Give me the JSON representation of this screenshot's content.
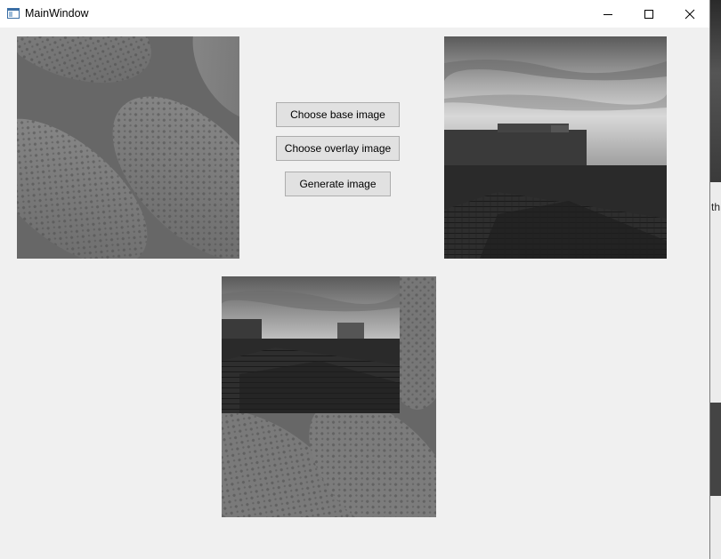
{
  "window": {
    "title": "MainWindow",
    "icon": "app-window-icon",
    "controls": [
      "minimize-icon",
      "maximize-icon",
      "close-icon"
    ]
  },
  "buttons": {
    "choose_base": "Choose base image",
    "choose_overlay": "Choose overlay image",
    "generate": "Generate image"
  },
  "images": {
    "base": "grayscale textured seeds photo",
    "overlay": "grayscale rooftops at sunset photo",
    "result": "overlay composited onto base"
  },
  "background_app": {
    "visible_text": "th"
  },
  "colors": {
    "window_bg": "#f0f0f0",
    "titlebar_bg": "#ffffff",
    "button_bg": "#e1e1e1",
    "button_border": "#adadad"
  }
}
